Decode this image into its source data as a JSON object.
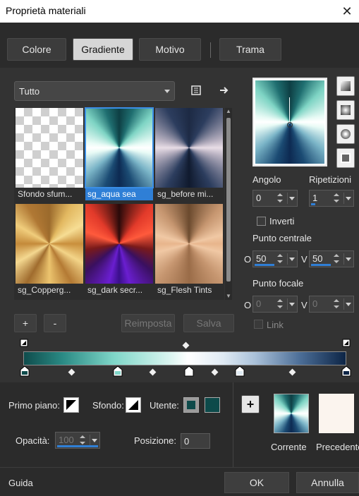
{
  "window": {
    "title": "Proprietà materiali"
  },
  "tabs": [
    {
      "label": "Colore",
      "active": false
    },
    {
      "label": "Gradiente",
      "active": true
    },
    {
      "label": "Motivo",
      "active": false
    },
    {
      "label": "Trama",
      "active": false
    }
  ],
  "category": {
    "selected": "Tutto"
  },
  "gradients": [
    {
      "label": "Sfondo sfum...",
      "selected": false
    },
    {
      "label": "sg_aqua sea",
      "selected": true
    },
    {
      "label": "sg_before mi...",
      "selected": false
    },
    {
      "label": "sg_Copperg...",
      "selected": false
    },
    {
      "label": "sg_dark secr...",
      "selected": false
    },
    {
      "label": "sg_Flesh Tints",
      "selected": false
    }
  ],
  "buttons": {
    "add": "+",
    "remove": "-",
    "reset": "Reimposta",
    "save": "Salva"
  },
  "settings": {
    "angle_label": "Angolo",
    "angle_value": "0",
    "repeats_label": "Ripetizioni",
    "repeats_value": "1",
    "invert_label": "Inverti",
    "center_label": "Punto centrale",
    "center_o_label": "O",
    "center_o_value": "50",
    "center_v_label": "V",
    "center_v_value": "50",
    "focal_label": "Punto focale",
    "focal_o_label": "O",
    "focal_o_value": "0",
    "focal_v_label": "V",
    "focal_v_value": "0",
    "link_label": "Link"
  },
  "bottom": {
    "foreground_label": "Primo piano:",
    "background_label": "Sfondo:",
    "user_label": "Utente:",
    "opacity_label": "Opacità:",
    "opacity_value": "100",
    "position_label": "Posizione:",
    "position_value": "0",
    "current_label": "Corrente",
    "previous_label": "Precedente"
  },
  "footer": {
    "help": "Guida",
    "ok": "OK",
    "cancel": "Annulla"
  },
  "colors": {
    "accent": "#2f7fd6",
    "user_color": "#0d4a4a",
    "previous_color": "#fbf4ee"
  }
}
